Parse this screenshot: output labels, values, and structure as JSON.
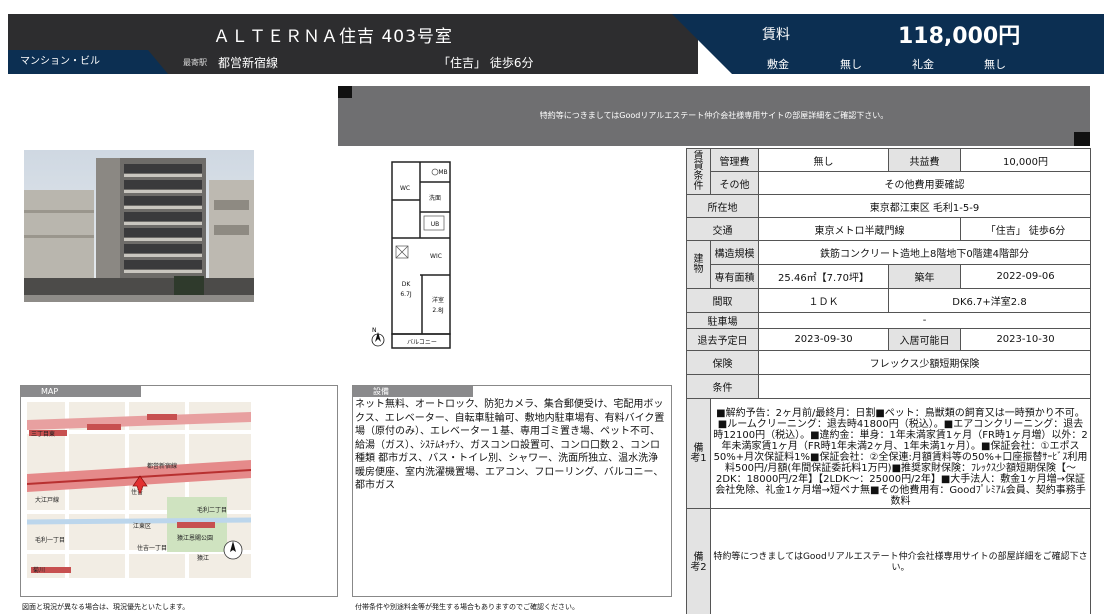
{
  "header": {
    "title": "ＡＬＴＥＲＮＡ住吉 403号室",
    "type": "マンション・ビル",
    "station_label": "最寄駅",
    "station": "都営新宿線",
    "access": "「住吉」 徒歩6分"
  },
  "price": {
    "rent_label": "賃料",
    "rent": "118,000円",
    "deposit_label": "敷金",
    "deposit": "無し",
    "key_money_label": "礼金",
    "key_money": "無し"
  },
  "banner": "特約等につきましてはGoodリアルエステート仲介会社様専用サイトの部屋詳細をご確認下さい。",
  "floorplan": {
    "labels": [
      "WC",
      "MB",
      "洗面",
      "UB",
      "WIC",
      "DK",
      "6.7J",
      "洋室",
      "2.8J",
      "バルコニー",
      "N"
    ]
  },
  "map": {
    "tab": "MAP",
    "labels": [
      "三丁目東",
      "大江戸線",
      "都営新宿線",
      "住吉",
      "毛利二丁目",
      "毛利一丁目",
      "江東区",
      "菊川",
      "住吉一丁目",
      "猿江",
      "猿江恩賜公園"
    ]
  },
  "equipment": {
    "tab": "設備",
    "text": "ネット無料、オートロック、防犯カメラ、集合郵便受け、宅配用ボックス、エレベーター、自転車駐輪可、敷地内駐車場有、有料バイク置場（原付のみ）、エレベーター１基、専用ゴミ置き場、ペット不可、給湯（ガス）、ｼｽﾃﾑｷｯﾁﾝ、ガスコンロ設置可、コンロ口数２、コンロ種類 都市ガス、バス・トイレ別、シャワー、洗面所独立、温水洗浄暖房便座、室内洗濯機置場、エアコン、フローリング、バルコニー、都市ガス"
  },
  "notes": {
    "map": "図面と現況が異なる場合は、現況優先といたします。",
    "equipment": "付帯条件や別途料金等が発生する場合もありますのでご確認ください。"
  },
  "spec": {
    "cond_group": "賃貸条件",
    "mgmt_label": "管理費",
    "mgmt": "無し",
    "common_label": "共益費",
    "common": "10,000円",
    "other_label": "その他",
    "other": "その他費用要確認",
    "addr_label": "所在地",
    "addr": "東京都江東区 毛利1-5-9",
    "traffic_label": "交通",
    "line": "東京メトロ半蔵門線",
    "walk": "「住吉」 徒歩6分",
    "bldg_group": "建物",
    "struct_label": "構造規模",
    "struct": "鉄筋コンクリート造地上8階地下0階建4階部分",
    "area_label": "専有面積",
    "area": "25.46㎡【7.70坪】",
    "year_label": "築年",
    "year": "2022-09-06",
    "layout_label": "間取",
    "layout": "１ＤＫ",
    "layout_detail": "DK6.7+洋室2.8",
    "parking_label": "駐車場",
    "parking": "-",
    "leave_label": "退去予定日",
    "leave": "2023-09-30",
    "move_label": "入居可能日",
    "move": "2023-10-30",
    "insurance_label": "保険",
    "insurance": "フレックス少額短期保険",
    "conditions_label": "条件",
    "conditions": "",
    "remarks1_label": "備考1",
    "remarks1": "■解約予告：2ヶ月前/最終月：日割■ペット：鳥獣類の飼育又は一時預かり不可。■ルームクリーニング：退去時41800円（税込）。■エアコンクリーニング：退去時12100円（税込）。■違約金：単身：1年未満家賃1ヶ月（FR時1ヶ月増）以外：2年未満家賃1ヶ月（FR時1年未満2ヶ月、1年未満1ヶ月）。■保証会社：①エポス50%+月次保証料1%■保証会社：②全保連:月額賃料等の50%+口座振替ｻｰﾋﾞｽ利用料500円/月額(年間保証委託料1万円)■推奨家財保険：ﾌﾚｯｸｽ少額短期保険【～2DK：18000円/2年】【2LDK～：25000円/2年】■大手法人：敷金1ヶ月増→保証会社免除、礼金1ヶ月増→短ペナ無■その他費用有：Goodﾌﾟﾚﾐｱﾑ会員、契約事務手数料",
    "remarks2_label": "備考2",
    "remarks2": "特約等につきましてはGoodリアルエステート仲介会社様専用サイトの部屋詳細をご確認下さい。"
  }
}
